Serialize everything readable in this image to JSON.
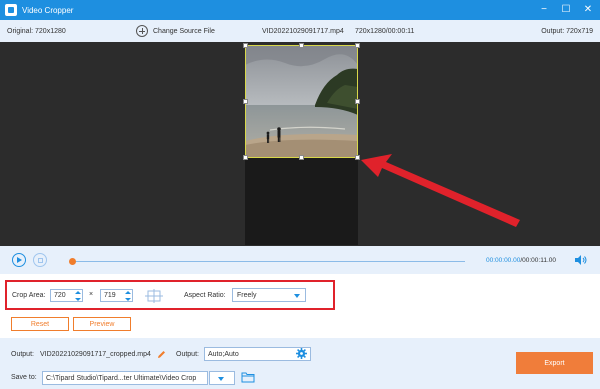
{
  "window": {
    "title": "Video Cropper",
    "controls": [
      "minimize-icon",
      "maximize-icon",
      "close-icon"
    ]
  },
  "info": {
    "original": "Original: 720x1280",
    "change_source": "Change Source File",
    "filename": "VID20221029091717.mp4",
    "meta": "720x1280/00:00:11",
    "output_size": "Output: 720x719"
  },
  "player": {
    "current_time": "00:00:00.00",
    "total_time": "/00:00:11.00",
    "progress": 0.0
  },
  "crop": {
    "label": "Crop Area:",
    "width": "720",
    "times": "×",
    "height": "719",
    "aspect_label": "Aspect Ratio:",
    "aspect_value": "Freely"
  },
  "buttons": {
    "reset": "Reset",
    "preview": "Preview",
    "export": "Export"
  },
  "output": {
    "label": "Output:",
    "filename": "VID20221029091717_cropped.mp4",
    "format_label": "Output:",
    "format_value": "Auto;Auto"
  },
  "save": {
    "label": "Save to:",
    "path": "C:\\Tipard Studio\\Tipard...ter Ultimate\\Video Crop"
  },
  "colors": {
    "accent": "#1e8fe0",
    "orange": "#f07d2c",
    "highlight": "#e0222b"
  }
}
